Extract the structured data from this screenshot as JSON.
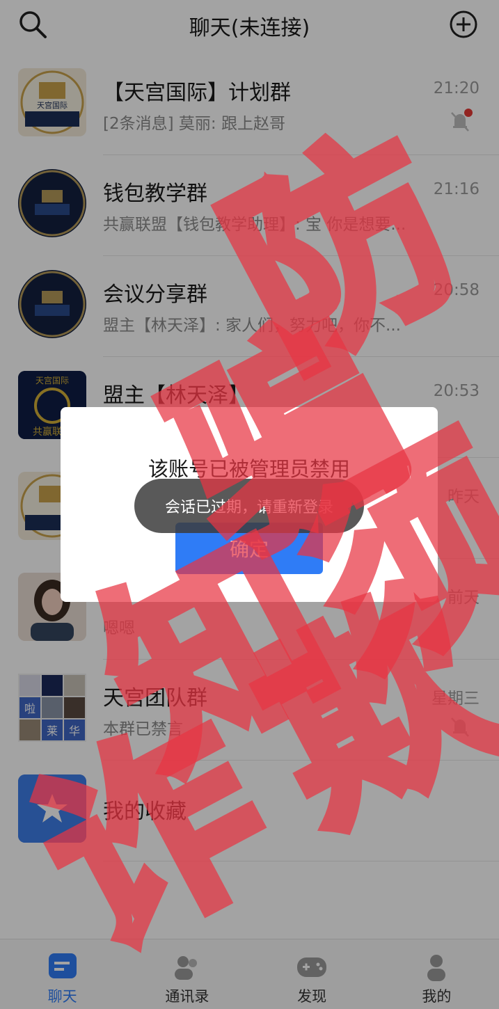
{
  "header": {
    "title": "聊天(未连接)",
    "search_icon": "search-icon",
    "add_icon": "plus-circle-icon"
  },
  "chats": [
    {
      "name": "【天宫国际】计划群",
      "preview": "[2条消息] 莫丽: 跟上赵哥",
      "time": "21:20",
      "muted": true,
      "badge": true
    },
    {
      "name": "钱包教学群",
      "preview": "共赢联盟【钱包教学助理】: 宝 你是想要...",
      "time": "21:16"
    },
    {
      "name": "会议分享群",
      "preview": "盟主【林天泽】: 家人们，努力吧，你不...",
      "time": "20:58"
    },
    {
      "name": "盟主【林天泽】",
      "preview": "",
      "time": "20:53"
    },
    {
      "name": "",
      "preview": "",
      "time": "昨天"
    },
    {
      "name": "",
      "preview": "嗯嗯",
      "time": "前天"
    },
    {
      "name": "天宫团队群",
      "preview": "本群已禁言",
      "time": "星期三",
      "muted": true
    },
    {
      "name": "我的收藏",
      "preview": "",
      "time": ""
    }
  ],
  "avatar_text": {
    "tg_logo_title": "天宫国际",
    "gold_badge_top": "天宫国际",
    "gold_badge_bottom": "共赢联盟",
    "grid_chars": [
      "啦",
      "莱",
      "华"
    ]
  },
  "dialog": {
    "message": "该账号已被管理员禁用",
    "confirm_label": "确定"
  },
  "toast": {
    "text": "会话已过期，请重新登录"
  },
  "tabs": [
    {
      "label": "聊天",
      "icon": "chat-icon",
      "active": true
    },
    {
      "label": "通讯录",
      "icon": "contacts-icon"
    },
    {
      "label": "发现",
      "icon": "gamepad-icon"
    },
    {
      "label": "我的",
      "icon": "person-icon"
    }
  ],
  "watermark": {
    "chars": [
      "防",
      "骗",
      "须",
      "知",
      "欺",
      "诈"
    ],
    "color": "#e73543"
  },
  "colors": {
    "accent": "#2f7cf6",
    "badge": "#e53935"
  }
}
